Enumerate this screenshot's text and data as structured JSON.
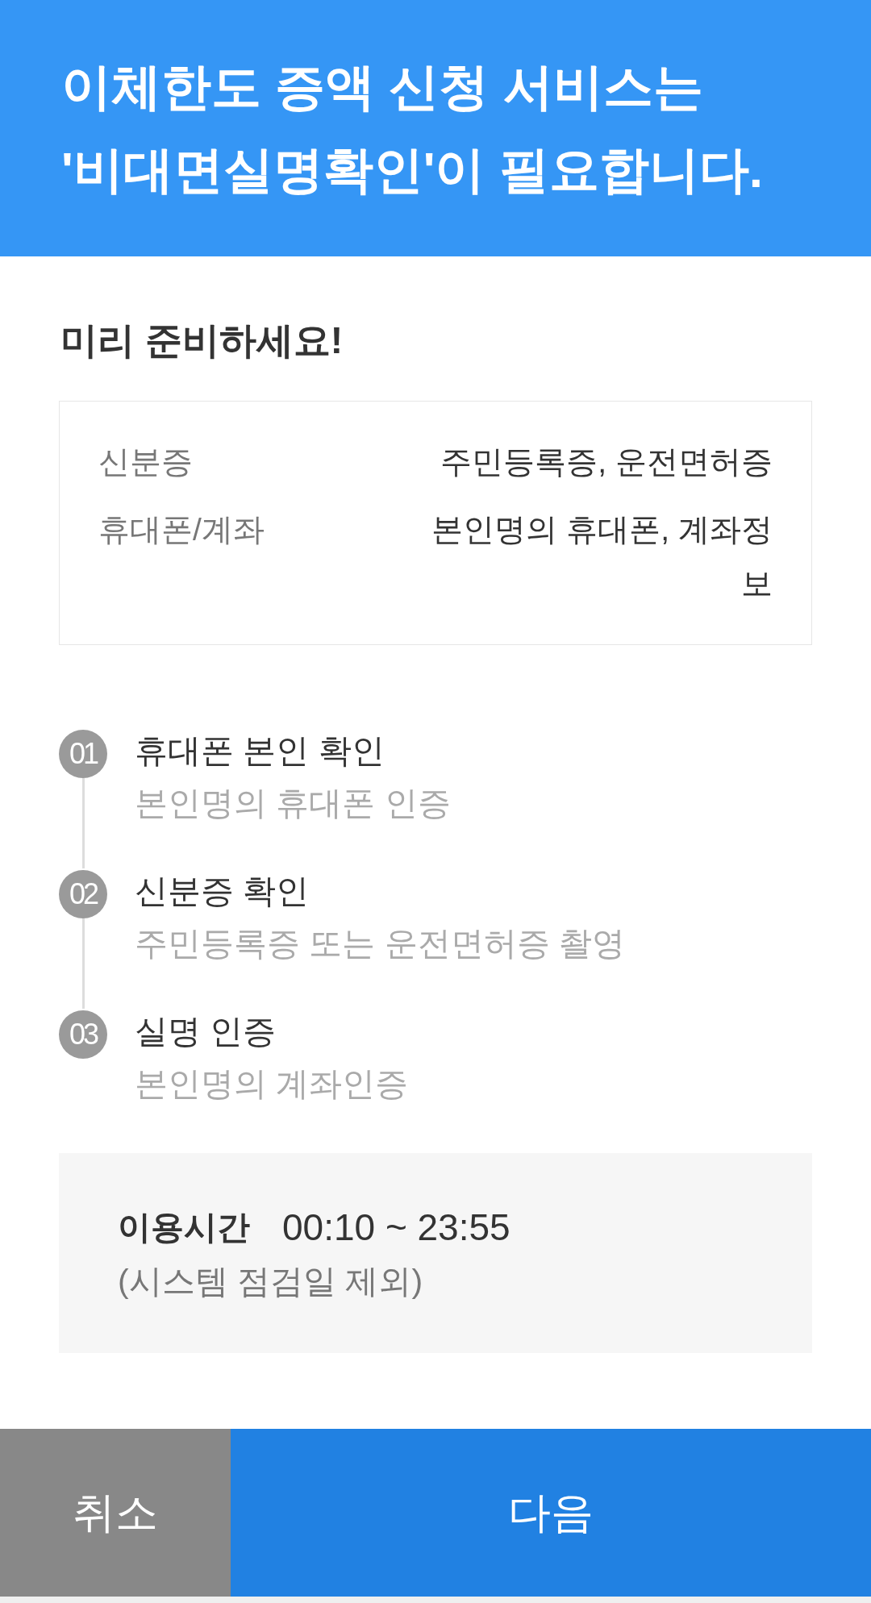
{
  "header": {
    "title": "이체한도 증액 신청 서비스는 '비대면실명확인'이 필요합니다."
  },
  "prepare": {
    "heading": "미리 준비하세요!",
    "items": [
      {
        "label": "신분증",
        "value": "주민등록증, 운전면허증"
      },
      {
        "label": "휴대폰/계좌",
        "value": "본인명의 휴대폰, 계좌정보"
      }
    ]
  },
  "steps": [
    {
      "number": "01",
      "title": "휴대폰 본인 확인",
      "description": "본인명의 휴대폰 인증"
    },
    {
      "number": "02",
      "title": "신분증 확인",
      "description": "주민등록증 또는 운전면허증 촬영"
    },
    {
      "number": "03",
      "title": "실명 인증",
      "description": "본인명의 계좌인증"
    }
  ],
  "hours": {
    "label": "이용시간",
    "value": "00:10 ~ 23:55",
    "note": "(시스템 점검일 제외)"
  },
  "buttons": [
    {
      "kind": "secondary",
      "label": "취소"
    },
    {
      "kind": "primary",
      "label": "다음"
    }
  ]
}
